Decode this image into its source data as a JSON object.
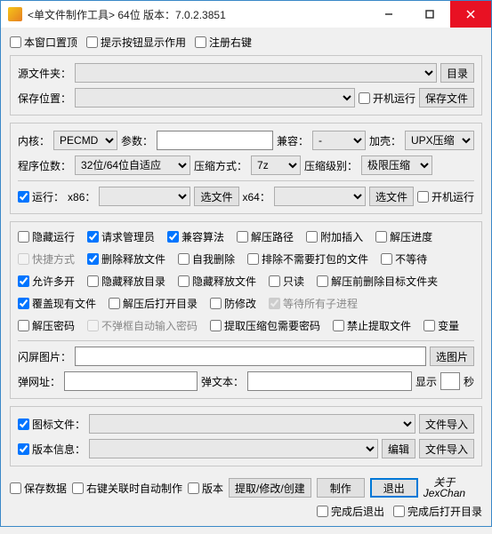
{
  "titlebar": {
    "title": "<单文件制作工具> 64位 版本：7.0.2.3851"
  },
  "top": {
    "pin": "本窗口置顶",
    "tipBtn": "提示按钮显示作用",
    "regRight": "注册右键"
  },
  "g1": {
    "srcLabel": "源文件夹：",
    "dirBtn": "目录",
    "saveLabel": "保存位置：",
    "bootRun": "开机运行",
    "saveBtn": "保存文件"
  },
  "g2": {
    "kernel": "内核：",
    "kernelSel": "PECMD",
    "params": "参数：",
    "compat": "兼容：",
    "compatSel": "-",
    "shell": "加壳：",
    "shellSel": "UPX压缩",
    "bits": "程序位数：",
    "bitsSel": "32位/64位自适应",
    "compMethod": "压缩方式：",
    "compMethodSel": "7z",
    "compLevel": "压缩级别：",
    "compLevelSel": "极限压缩",
    "run": "运行：",
    "x86": "x86：",
    "selFile": "选文件",
    "x64": "x64：",
    "bootRun2": "开机运行"
  },
  "g3": {
    "hideRun": "隐藏运行",
    "reqAdmin": "请求管理员",
    "compatAlgo": "兼容算法",
    "extractPath": "解压路径",
    "attachPlugin": "附加插入",
    "extractProgress": "解压进度",
    "shortcut": "快捷方式",
    "delRelease": "删除释放文件",
    "selfDel": "自我删除",
    "excludeNoPack": "排除不需要打包的文件",
    "noWait": "不等待",
    "allowMulti": "允许多开",
    "hideReleaseDir": "隐藏释放目录",
    "hideReleaseFile": "隐藏释放文件",
    "readonly": "只读",
    "delTargetBefore": "解压前删除目标文件夹",
    "overwrite": "覆盖现有文件",
    "openDirAfter": "解压后打开目录",
    "antiModify": "防修改",
    "waitChild": "等待所有子进程",
    "extractPwd": "解压密码",
    "noAutoPwdPrompt": "不弹框自动输入密码",
    "extractNeedPwd": "提取压缩包需要密码",
    "forbidExtract": "禁止提取文件",
    "variable": "变量",
    "splashImg": "闪屏图片：",
    "selImgBtn": "选图片",
    "popUrl": "弹网址：",
    "popText": "弹文本：",
    "show": "显示",
    "sec": "秒"
  },
  "g4": {
    "iconFile": "图标文件：",
    "fileImport": "文件导入",
    "verInfo": "版本信息：",
    "edit": "编辑"
  },
  "bottom": {
    "saveData": "保存数据",
    "autoOnRight": "右键关联时自动制作",
    "version": "版本",
    "extractBtn": "提取/修改/创建",
    "makeBtn": "制作",
    "exitBtn": "退出",
    "about1": "关于",
    "about2": "JexChan",
    "exitAfter": "完成后退出",
    "openDirAfter": "完成后打开目录"
  }
}
